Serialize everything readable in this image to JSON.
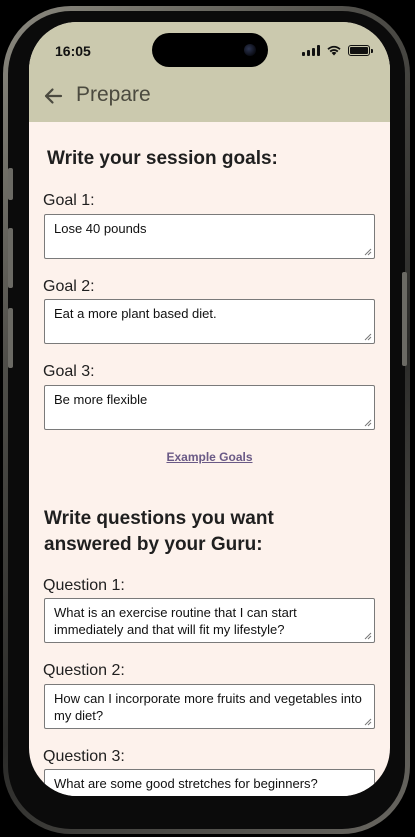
{
  "status_bar": {
    "time": "16:05",
    "icons": [
      "signal-icon",
      "wifi-icon",
      "battery-icon"
    ]
  },
  "app_bar": {
    "back_icon": "arrow-left-icon",
    "title": "Prepare",
    "background": "#cbc9ae"
  },
  "goals_section": {
    "title": "Write your session goals:",
    "goals": [
      {
        "label": "Goal 1:",
        "value": "Lose 40 pounds"
      },
      {
        "label": "Goal 2:",
        "value": "Eat a more plant based diet."
      },
      {
        "label": "Goal 3:",
        "value": "Be more flexible"
      }
    ],
    "example_link": "Example Goals"
  },
  "questions_section": {
    "title": "Write questions you want answered by your Guru:",
    "questions": [
      {
        "label": "Question 1:",
        "value": "What is an exercise routine that I can start immediately and that will fit my lifestyle?"
      },
      {
        "label": "Question 2:",
        "value": "How can I incorporate more fruits and vegetables into my diet?"
      },
      {
        "label": "Question 3:",
        "value": "What are some good stretches for beginners?"
      }
    ]
  },
  "colors": {
    "page_background": "#fdf2ec",
    "link": "#6a5a86"
  }
}
